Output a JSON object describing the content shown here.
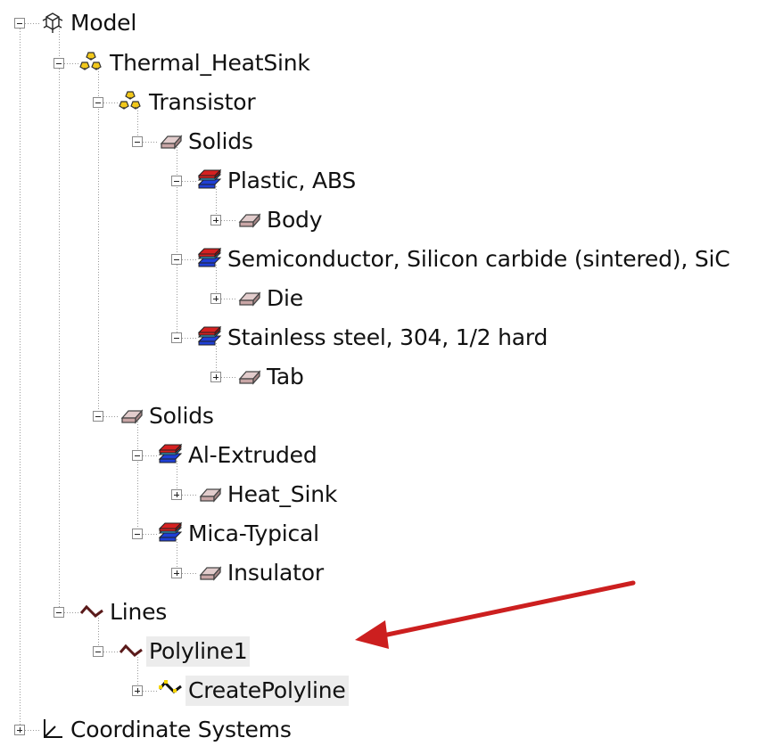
{
  "tree": {
    "model": {
      "label": "Model",
      "icon": "model-icon"
    },
    "thermal_heatsink": {
      "label": "Thermal_HeatSink",
      "icon": "group-icon"
    },
    "transistor": {
      "label": "Transistor",
      "icon": "group-icon"
    },
    "transistor_solids": {
      "label": "Solids",
      "icon": "solid-icon"
    },
    "plastic_abs": {
      "label": "Plastic, ABS",
      "icon": "material-icon"
    },
    "body": {
      "label": "Body",
      "icon": "solid-icon"
    },
    "semiconductor": {
      "label": "Semiconductor, Silicon carbide (sintered), SiC",
      "icon": "material-icon"
    },
    "die": {
      "label": "Die",
      "icon": "solid-icon"
    },
    "stainless": {
      "label": "Stainless steel, 304, 1/2 hard",
      "icon": "material-icon"
    },
    "tab": {
      "label": "Tab",
      "icon": "solid-icon"
    },
    "solids": {
      "label": "Solids",
      "icon": "solid-icon"
    },
    "al_extruded": {
      "label": "Al-Extruded",
      "icon": "material-icon"
    },
    "heat_sink": {
      "label": "Heat_Sink",
      "icon": "solid-icon"
    },
    "mica": {
      "label": "Mica-Typical",
      "icon": "material-icon"
    },
    "insulator": {
      "label": "Insulator",
      "icon": "solid-icon"
    },
    "lines": {
      "label": "Lines",
      "icon": "line-icon"
    },
    "polyline1": {
      "label": "Polyline1",
      "icon": "line-icon"
    },
    "create_polyline": {
      "label": "CreatePolyline",
      "icon": "create-line-icon"
    },
    "coordinate_systems": {
      "label": "Coordinate Systems",
      "icon": "axes-icon"
    }
  },
  "colors": {
    "arrow": "#cc1f1f",
    "material_top": "#d62020",
    "material_bottom": "#1f3fd6",
    "material_mid": "#36b6e6",
    "solid_fill": "#c9a6a6",
    "group_yellow": "#f2c81a",
    "selection_bg": "#ececec"
  }
}
